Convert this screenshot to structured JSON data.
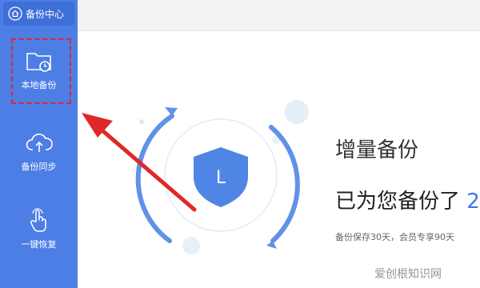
{
  "sidebar": {
    "header": {
      "label": "备份中心",
      "icon": "home-icon"
    },
    "items": [
      {
        "label": "本地备份",
        "icon": "folder-clock-icon",
        "selected": true
      },
      {
        "label": "备份同步",
        "icon": "cloud-upload-icon"
      },
      {
        "label": "一键恢复",
        "icon": "hand-pointer-icon"
      }
    ]
  },
  "main": {
    "title": "增量备份",
    "subtitle_prefix": "已为您备份了",
    "subtitle_count": "2",
    "description": "备份保存30天，会员专享90天",
    "shield_letter": "L"
  },
  "watermark": "爱创根知识网",
  "colors": {
    "sidebar": "#4c7ee6",
    "accent": "#3f76e2",
    "highlight": "#e02828",
    "arrow": "#e02828"
  }
}
